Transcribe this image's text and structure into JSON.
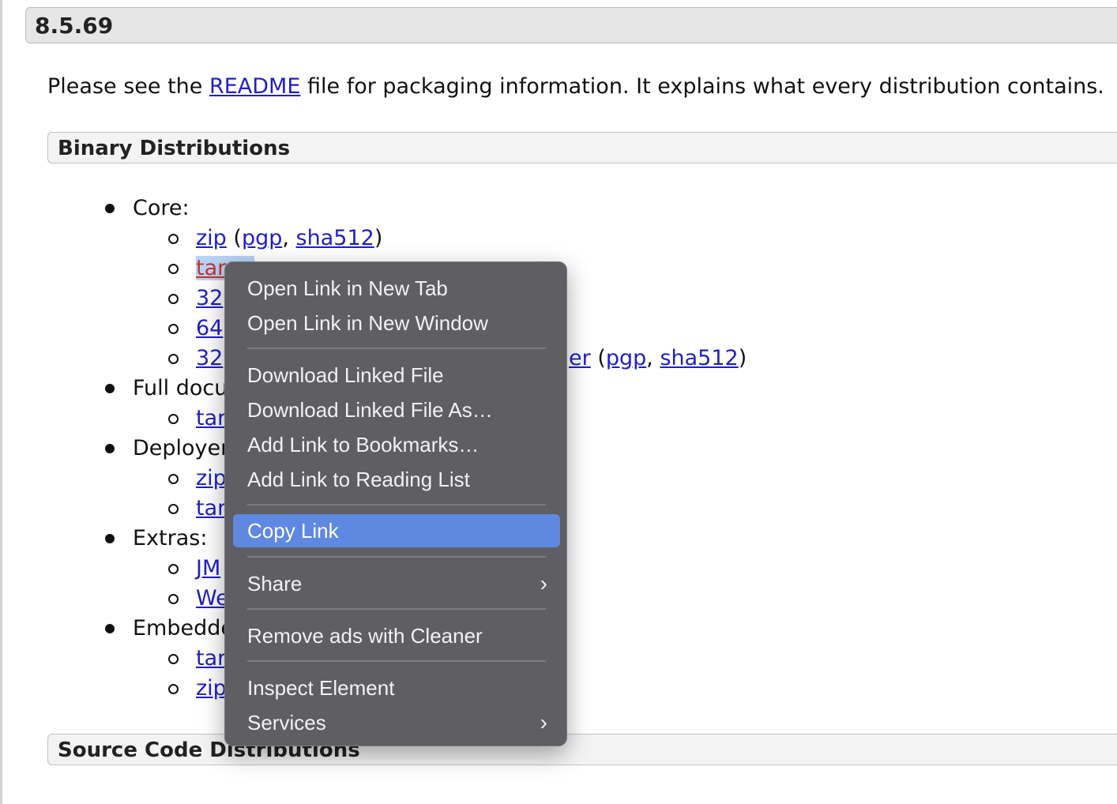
{
  "version_title": "8.5.69",
  "intro": {
    "before": "Please see the ",
    "readme_link": "README",
    "after": " file for packaging information. It explains what every distribution contains."
  },
  "sections": {
    "binary": "Binary Distributions",
    "source": "Source Code Distributions"
  },
  "list": {
    "core": "Core:",
    "core_items": {
      "zip": "zip",
      "tar": "tar",
      "item3": "32",
      "item4": "64",
      "item5": "32",
      "item5_tail": "er",
      "pgp": "pgp",
      "sha512": "sha512",
      "open_paren": "(",
      "comma": ", ",
      "close_paren": ")"
    },
    "full_docs": "Full docu",
    "full_docs_item": "tar",
    "deployer": "Deployer",
    "deployer_items": [
      "zip",
      "tar"
    ],
    "extras": "Extras:",
    "extras_items": [
      "JM",
      "We"
    ],
    "embedded": "Embedde",
    "embedded_items": [
      "tar",
      "zip"
    ]
  },
  "context_menu": {
    "items": [
      {
        "label": "Open Link in New Tab"
      },
      {
        "label": "Open Link in New Window"
      },
      {
        "label": "Download Linked File"
      },
      {
        "label": "Download Linked File As…"
      },
      {
        "label": "Add Link to Bookmarks…"
      },
      {
        "label": "Add Link to Reading List"
      },
      {
        "label": "Copy Link",
        "highlighted": true
      },
      {
        "label": "Share",
        "submenu": true
      },
      {
        "label": "Remove ads with Cleaner"
      },
      {
        "label": "Inspect Element"
      },
      {
        "label": "Services",
        "submenu": true
      }
    ],
    "chevron_glyph": "›",
    "highlight_color": "#5f88e0"
  }
}
